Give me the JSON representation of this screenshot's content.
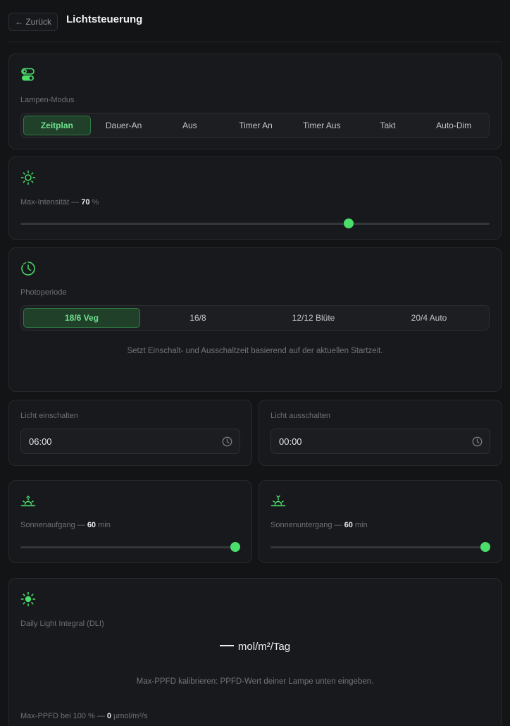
{
  "header": {
    "back_label": "← Zurück",
    "title": "Lichtsteuerung"
  },
  "mode": {
    "label": "Lampen-Modus",
    "icon": "toggle-icon",
    "options": [
      "Zeitplan",
      "Dauer-An",
      "Aus",
      "Timer An",
      "Timer Aus",
      "Takt",
      "Auto-Dim"
    ],
    "selected": "Zeitplan"
  },
  "intensity": {
    "label": "Max-Intensität — ",
    "value": "70",
    "unit": " %",
    "level_percent": 70,
    "icon": "sun-outline-icon"
  },
  "photoperiod": {
    "label": "Photoperiode",
    "icon": "clock-icon",
    "options": [
      "18/6 Veg",
      "16/8",
      "12/12 Blüte",
      "20/4 Auto"
    ],
    "selected": "18/6 Veg",
    "hint": "Setzt Einschalt- und Ausschaltzeit basierend auf der aktuellen Startzeit."
  },
  "light_on": {
    "label": "Licht einschalten",
    "value": "06:00"
  },
  "light_off": {
    "label": "Licht ausschalten",
    "value": "00:00"
  },
  "sunrise": {
    "label": "Sonnenaufgang — ",
    "value": "60",
    "unit": " min",
    "level_percent": 100,
    "icon": "sunrise-icon"
  },
  "sunset": {
    "label": "Sonnenuntergang — ",
    "value": "60",
    "unit": " min",
    "level_percent": 100,
    "icon": "sunset-icon"
  },
  "dli": {
    "label": "Daily Light Integral (DLI)",
    "icon": "sun-filled-icon",
    "unit": "mol/m²/Tag",
    "hint": "Max-PPFD kalibrieren: PPFD-Wert deiner Lampe unten eingeben.",
    "ppfd_label": "Max-PPFD bei 100 % — ",
    "ppfd_value": "0",
    "ppfd_unit": " µmol/m²/s"
  },
  "colors": {
    "accent": "#4ade6a",
    "accent_dark": "#20402a",
    "background": "#131416",
    "card": "#18191c"
  }
}
